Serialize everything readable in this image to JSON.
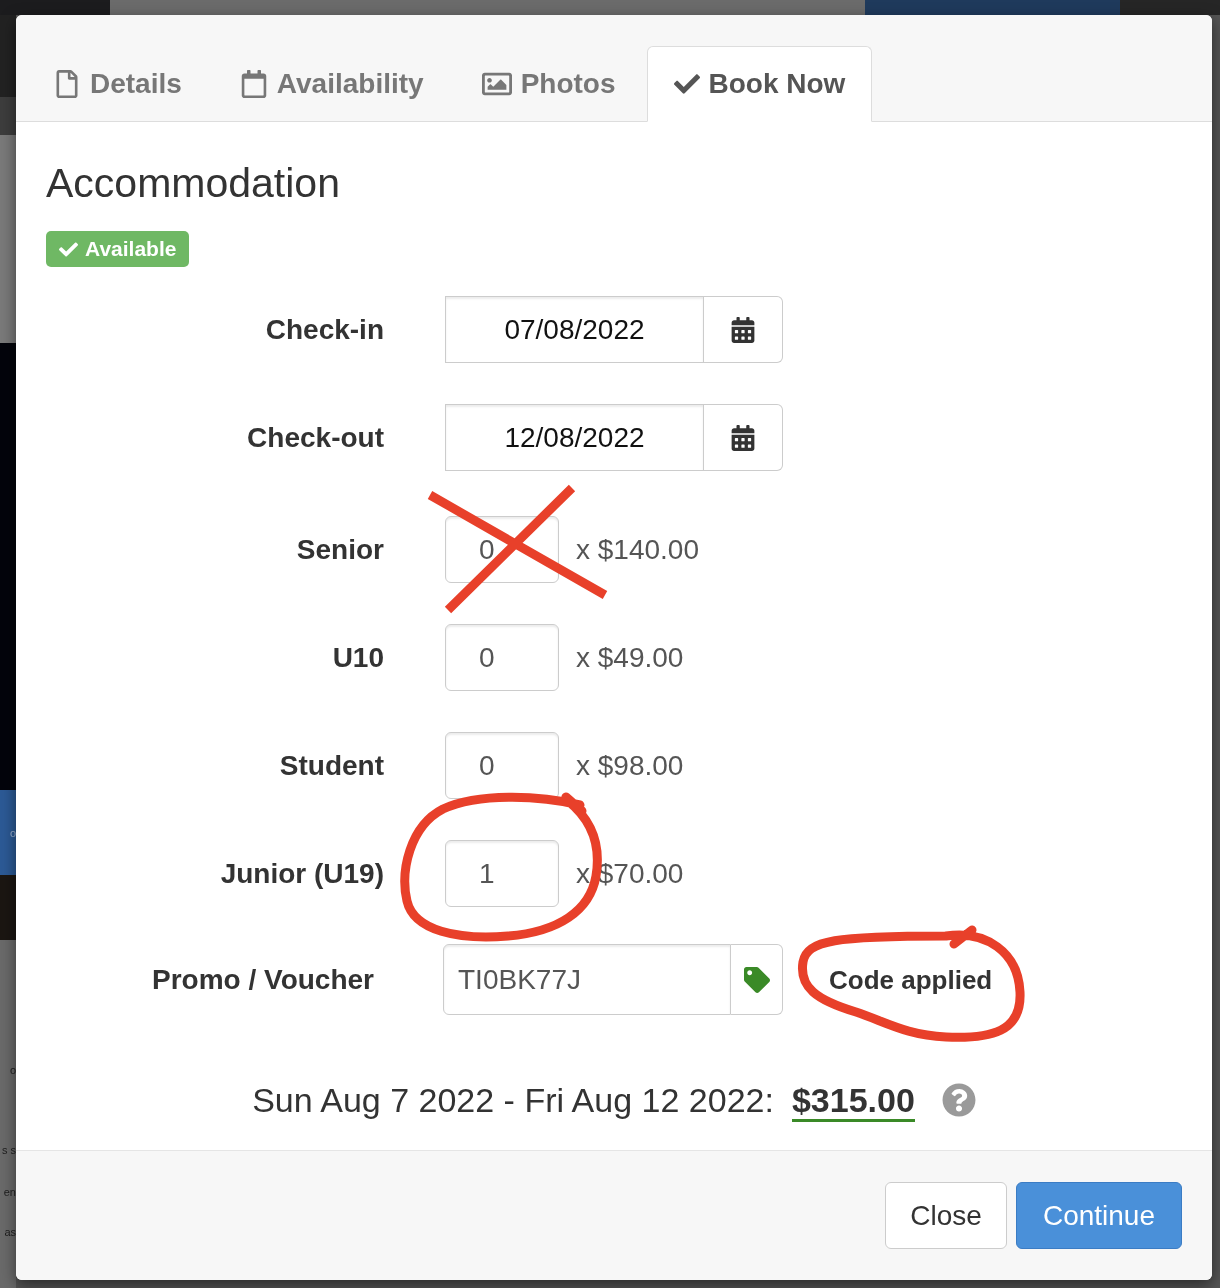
{
  "background_page": {
    "button_text": "o",
    "text_fragments": [
      "o",
      "s s",
      "en",
      "as"
    ]
  },
  "modal": {
    "tabs": [
      {
        "label": "Details",
        "selected": false
      },
      {
        "label": "Availability",
        "selected": false
      },
      {
        "label": "Photos",
        "selected": false
      },
      {
        "label": "Book Now",
        "selected": true
      }
    ],
    "title": "Accommodation",
    "status_badge": "Available",
    "date_fields": [
      {
        "label": "Check-in",
        "value": "07/08/2022"
      },
      {
        "label": "Check-out",
        "value": "12/08/2022"
      }
    ],
    "guests": [
      {
        "label": "Senior",
        "value": "0",
        "price": "x $140.00",
        "crossed_out": true,
        "circled": false
      },
      {
        "label": "U10",
        "value": "0",
        "price": "x $49.00",
        "crossed_out": false,
        "circled": false
      },
      {
        "label": "Student",
        "value": "0",
        "price": "x $98.00",
        "crossed_out": false,
        "circled": false
      },
      {
        "label": "Junior (U19)",
        "value": "1",
        "price": "x $70.00",
        "crossed_out": false,
        "circled": true
      }
    ],
    "promo": {
      "label": "Promo / Voucher",
      "value": "TI0BK77J",
      "status": "Code applied",
      "circled": true
    },
    "summary": {
      "dates": "Sun Aug 7 2022 - Fri Aug 12 2022:",
      "total": "$315.00"
    },
    "buttons": [
      {
        "label": "Close",
        "kind": "default"
      },
      {
        "label": "Continue",
        "kind": "primary"
      }
    ]
  }
}
